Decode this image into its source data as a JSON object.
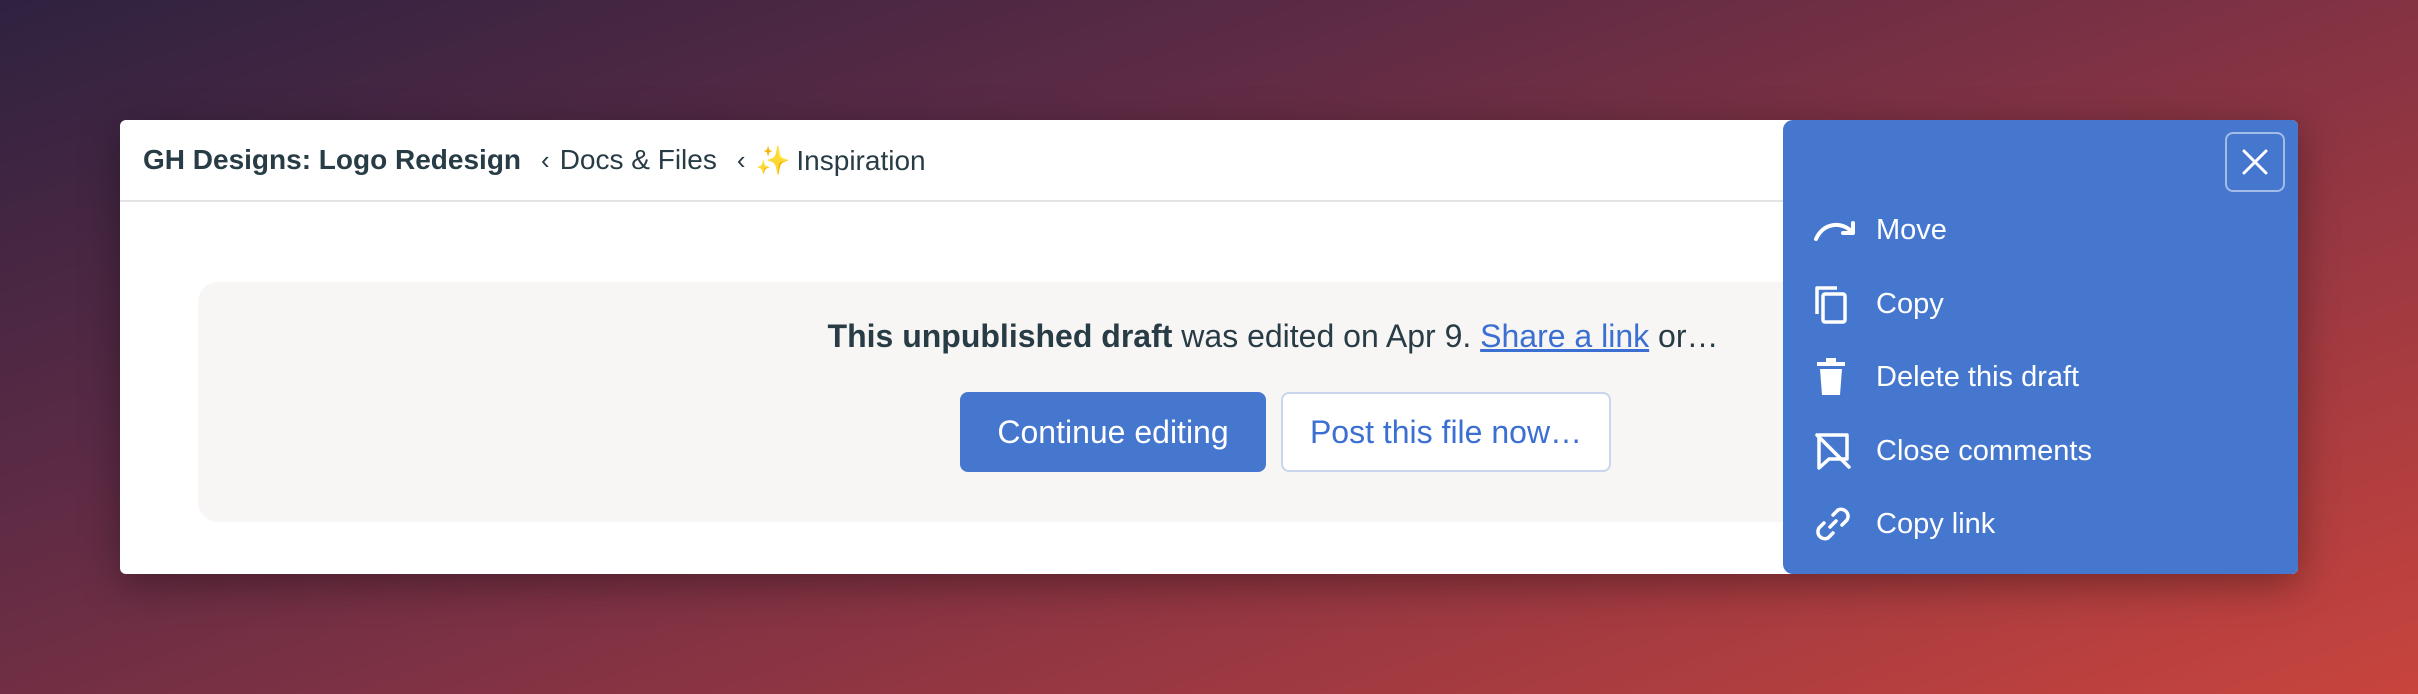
{
  "breadcrumb": {
    "project": "GH Designs: Logo Redesign",
    "separator": "‹",
    "section": "Docs & Files",
    "folder_icon": "✨",
    "folder": "Inspiration"
  },
  "draft": {
    "bold_text": "This unpublished draft",
    "middle_text": " was edited on Apr 9. ",
    "share_link": "Share a link",
    "trailing_text": " or…",
    "continue_button": "Continue editing",
    "post_button": "Post this file now…"
  },
  "menu": {
    "items": [
      {
        "label": "Move",
        "icon": "move-arrow-icon"
      },
      {
        "label": "Copy",
        "icon": "copy-icon"
      },
      {
        "label": "Delete this draft",
        "icon": "trash-icon"
      },
      {
        "label": "Close comments",
        "icon": "comments-off-icon"
      },
      {
        "label": "Copy link",
        "icon": "link-icon"
      }
    ],
    "close_icon": "close-icon"
  },
  "colors": {
    "accent": "#4677cf",
    "link": "#3b6fd1",
    "text": "#283c46",
    "panel_bg": "#f7f6f4"
  }
}
